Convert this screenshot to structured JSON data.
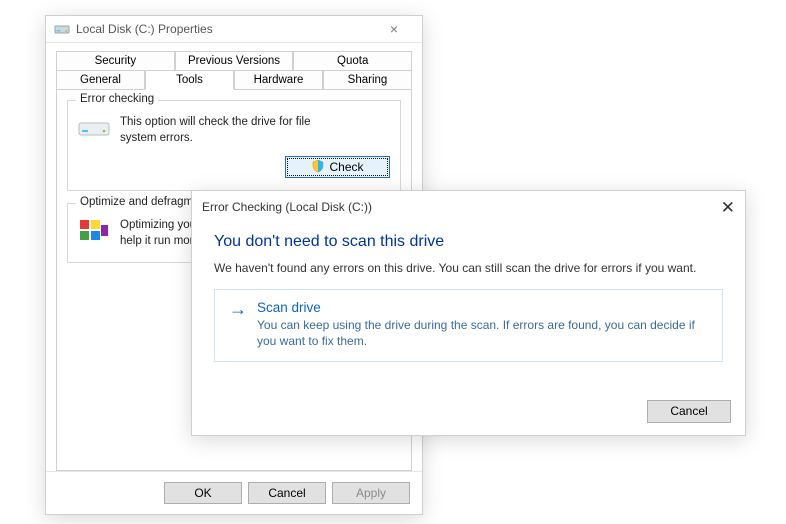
{
  "props": {
    "title": "Local Disk (C:) Properties",
    "tabs_row1": [
      "Security",
      "Previous Versions",
      "Quota"
    ],
    "tabs_row2": [
      "General",
      "Tools",
      "Hardware",
      "Sharing"
    ],
    "active_tab": "Tools",
    "error_check": {
      "legend": "Error checking",
      "text": "This option will check the drive for file system errors.",
      "button": "Check"
    },
    "defrag": {
      "legend": "Optimize and defragment drive",
      "text": "Optimizing your computer's drives can help it run more efficiently..."
    },
    "buttons": {
      "ok": "OK",
      "cancel": "Cancel",
      "apply": "Apply"
    }
  },
  "dialog": {
    "title": "Error Checking (Local Disk (C:))",
    "heading": "You don't need to scan this drive",
    "message": "We haven't found any errors on this drive. You can still scan the drive for errors if you want.",
    "option_title": "Scan drive",
    "option_desc": "You can keep using the drive during the scan. If errors are found, you can decide if you want to fix them.",
    "cancel": "Cancel"
  }
}
